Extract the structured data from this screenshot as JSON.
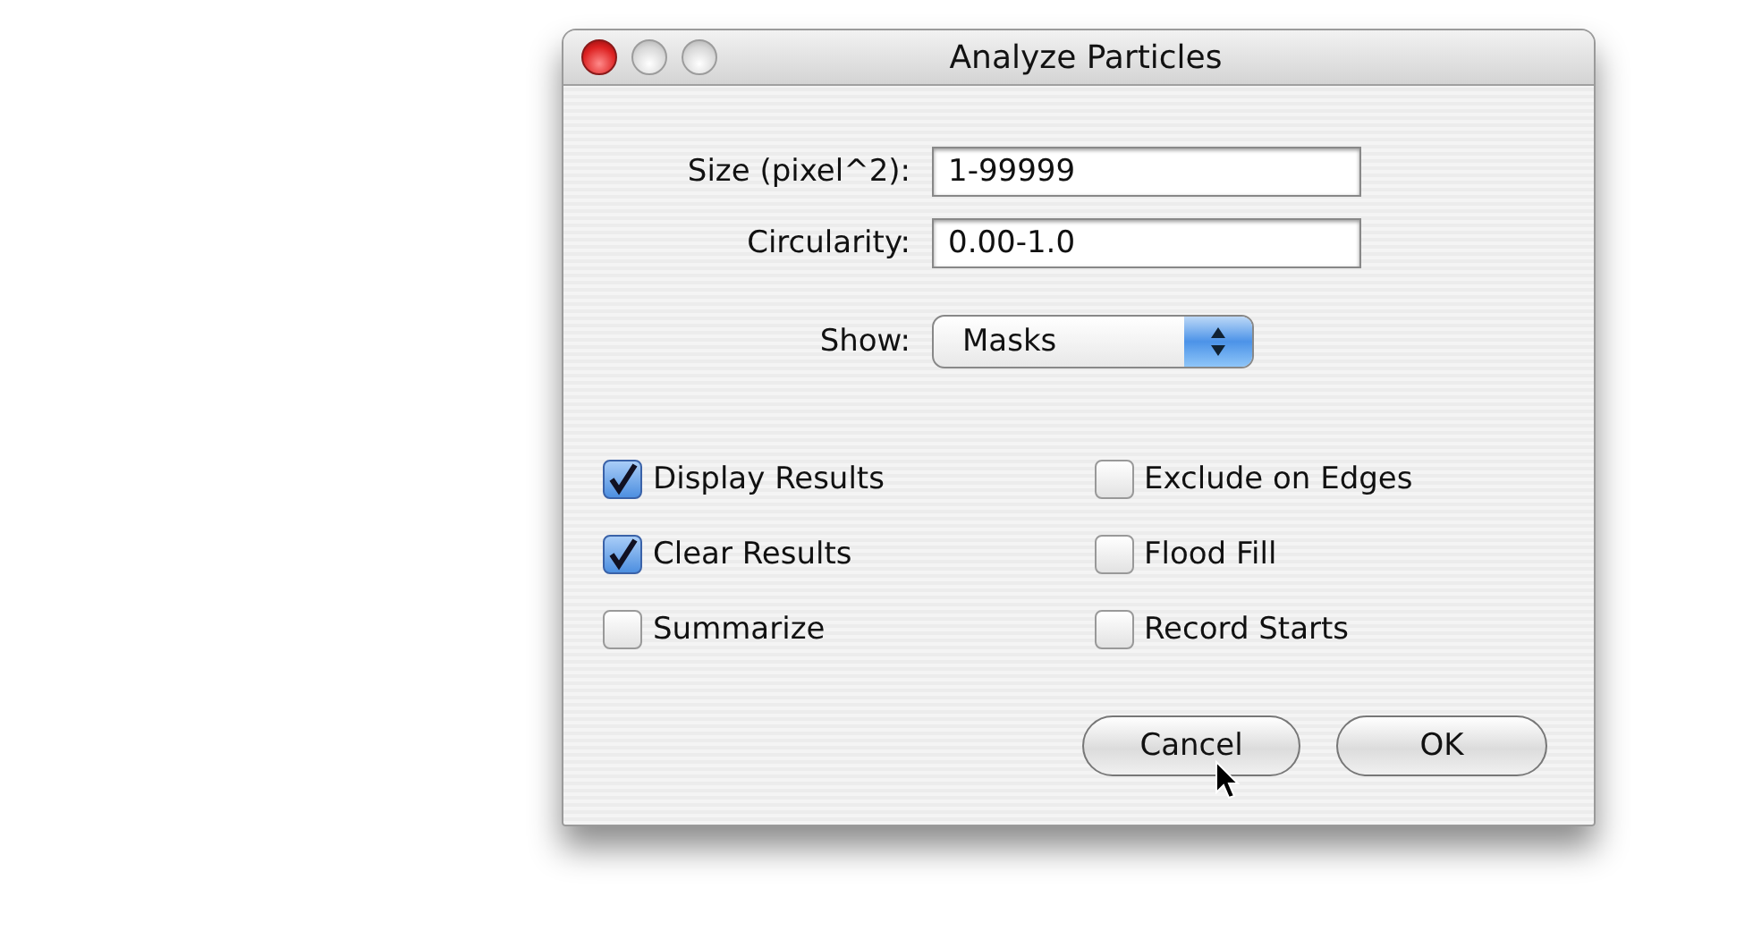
{
  "window": {
    "title": "Analyze Particles"
  },
  "fields": [
    {
      "label": "Size (pixel^2):",
      "value": "1-99999"
    },
    {
      "label": "Circularity:",
      "value": "0.00-1.0"
    }
  ],
  "show": {
    "label": "Show:",
    "value": "Masks"
  },
  "option_columns": [
    {
      "items": [
        {
          "label": "Display Results",
          "checked": true
        },
        {
          "label": "Clear Results",
          "checked": true
        },
        {
          "label": "Summarize",
          "checked": false
        }
      ]
    },
    {
      "items": [
        {
          "label": "Exclude on Edges",
          "checked": false
        },
        {
          "label": "Flood Fill",
          "checked": false
        },
        {
          "label": "Record Starts",
          "checked": false
        }
      ]
    }
  ],
  "buttons": [
    {
      "label": "Cancel"
    },
    {
      "label": "OK"
    }
  ]
}
